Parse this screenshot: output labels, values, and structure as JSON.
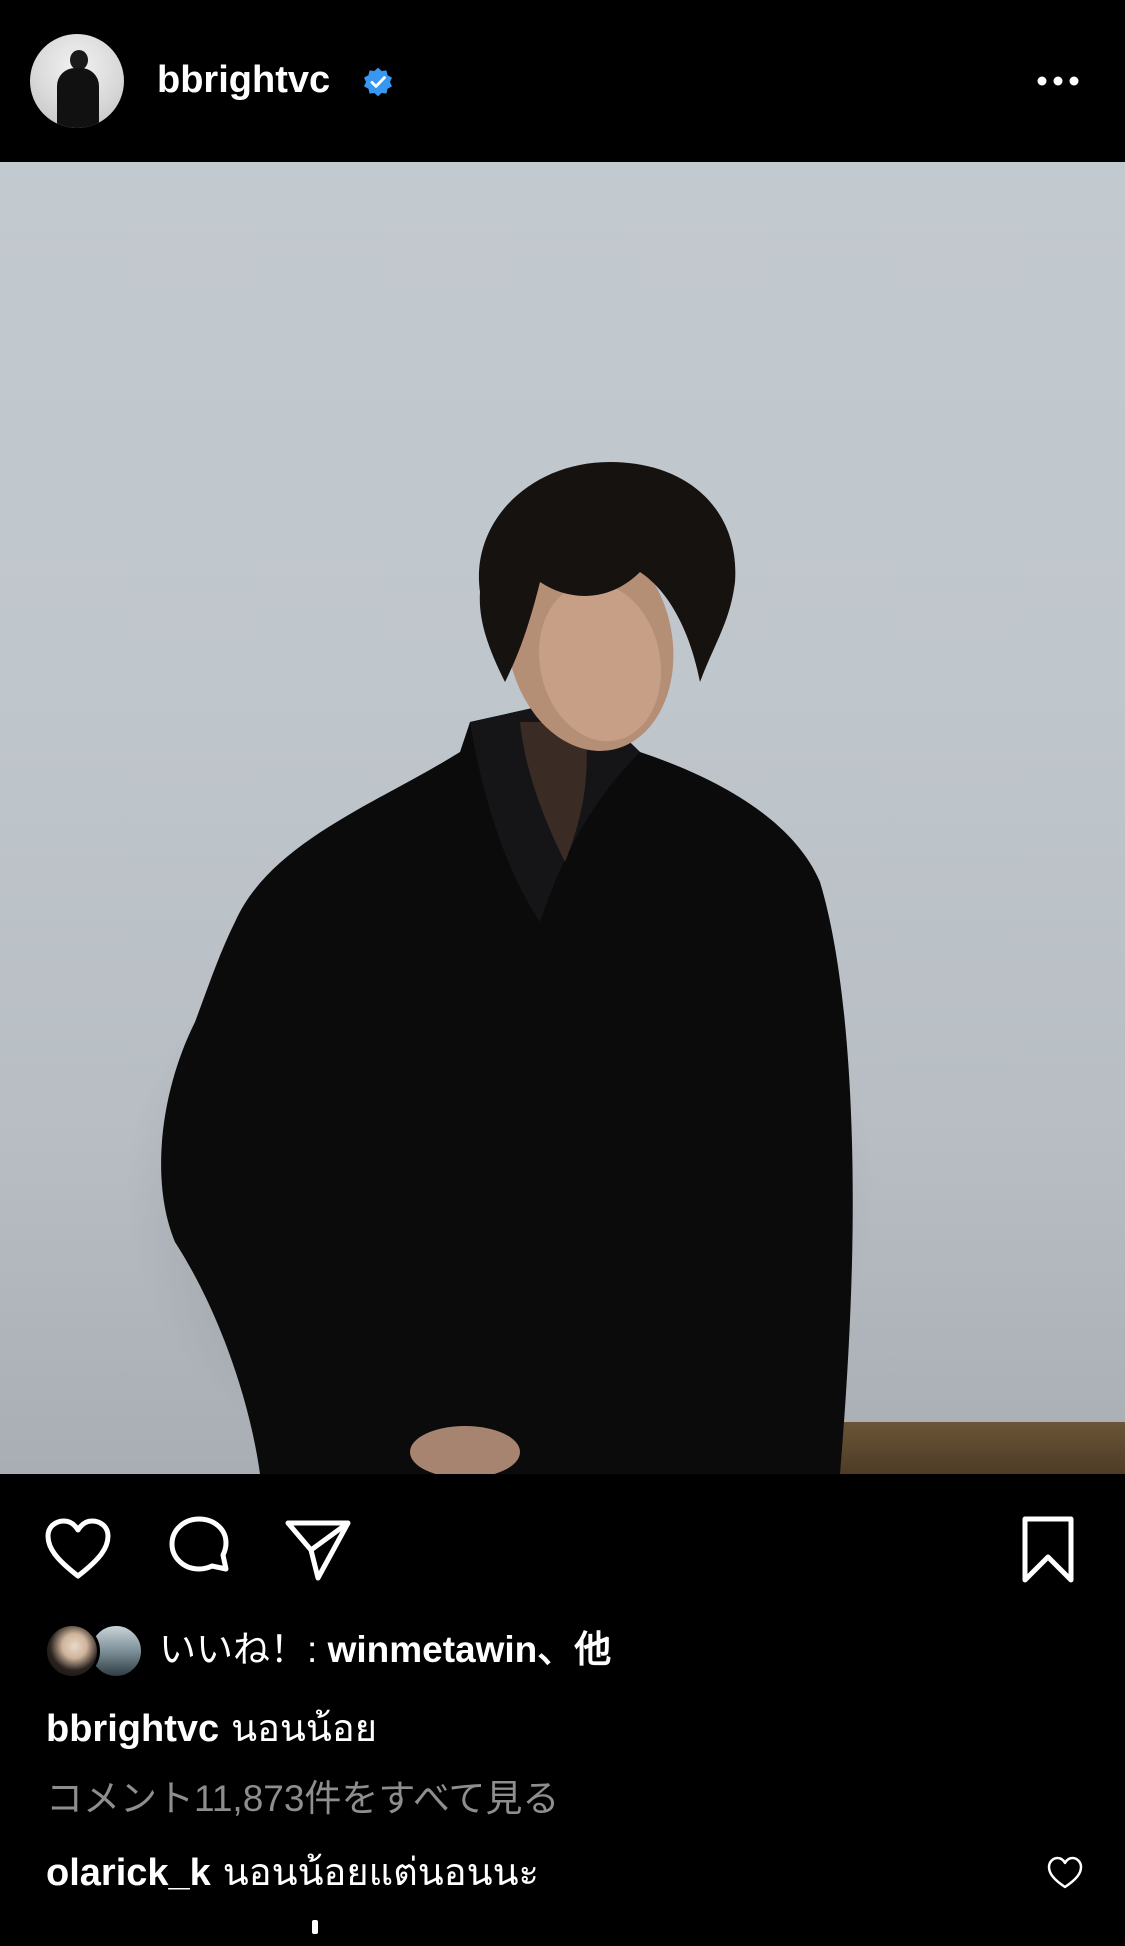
{
  "post": {
    "username": "bbrightvc",
    "verified": true,
    "verified_icon": "verified-badge-icon",
    "more_icon": "more-options-icon"
  },
  "actions": {
    "like_icon": "heart-icon",
    "comment_icon": "comment-icon",
    "share_icon": "paper-plane-icon",
    "save_icon": "bookmark-icon"
  },
  "likes": {
    "prefix": "いいね！: ",
    "user": "winmetawin",
    "suffix": "、他"
  },
  "caption": {
    "user": "bbrightvc",
    "text": "นอนน้อย"
  },
  "view_comments": "コメント11,873件をすべて見る",
  "comment": {
    "user": "olarick_k",
    "text": "นอนน้อยแต่นอนนะ",
    "like_icon": "heart-icon"
  },
  "colors": {
    "background": "#000000",
    "verified_blue": "#3897f0",
    "muted_text": "#8e8e8e"
  }
}
